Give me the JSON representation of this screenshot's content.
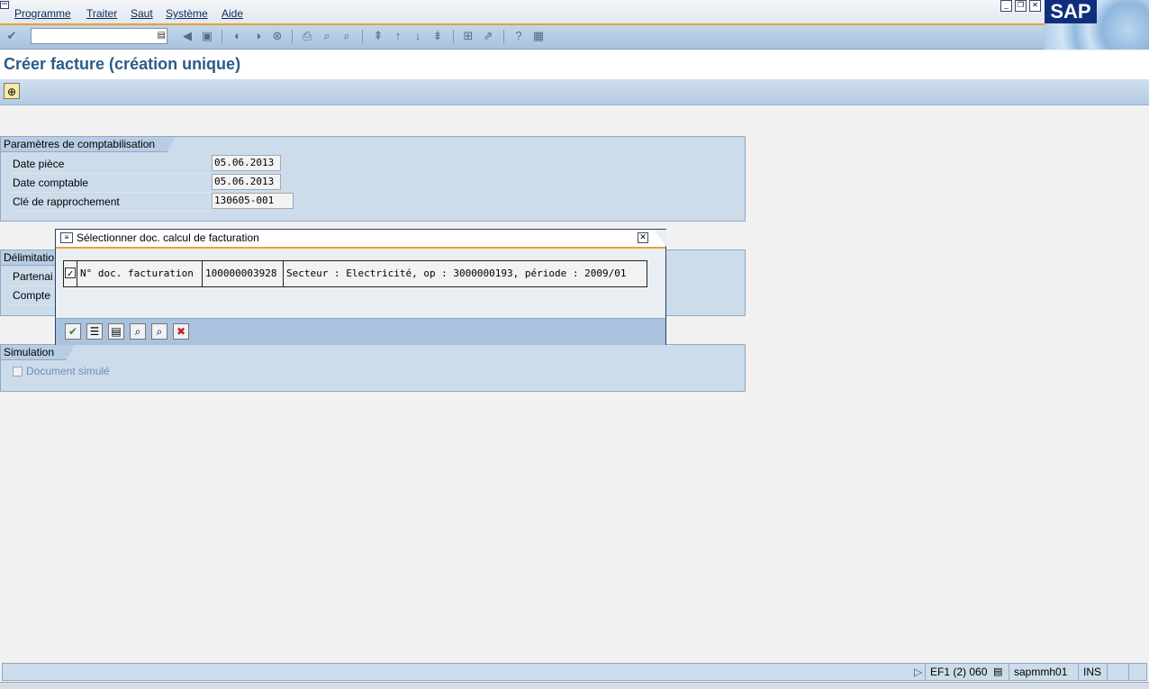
{
  "menu": {
    "items": [
      "Programme",
      "Traiter",
      "Saut",
      "Système",
      "Aide"
    ]
  },
  "logo": "SAP",
  "toolbar": {
    "command_value": "",
    "icons": [
      "enter-icon",
      "back-icon",
      "save-icon",
      "back-nav-icon",
      "exit-icon",
      "cancel-icon",
      "print-icon",
      "find-icon",
      "find-next-icon",
      "first-page-icon",
      "prev-page-icon",
      "next-page-icon",
      "last-page-icon",
      "new-session-icon",
      "shortcut-icon",
      "help-icon",
      "customize-layout-icon"
    ]
  },
  "page": {
    "title": "Créer facture (création unique)"
  },
  "posting": {
    "title": "Paramètres de comptabilisation",
    "date_piece_label": "Date pièce",
    "date_piece_value": "05.06.2013",
    "date_comptable_label": "Date comptable",
    "date_comptable_value": "05.06.2013",
    "cle_label": "Clé de rapprochement",
    "cle_value": "130605-001"
  },
  "delimitation": {
    "title": "Délimitatio",
    "partner_label": "Partenai",
    "account_label": "Compte"
  },
  "simulation": {
    "title": "Simulation",
    "checkbox_label": "Document simulé",
    "checked": false
  },
  "dialog": {
    "title": "Sélectionner doc. calcul de facturation",
    "row": {
      "checked": true,
      "label": "N° doc. facturation",
      "number": "100000003928",
      "description": "Secteur : Electricité, op : 3000000193, période : 2009/01"
    },
    "buttons": [
      "confirm-icon",
      "select-all-icon",
      "deselect-all-icon",
      "find-icon",
      "find-next-icon",
      "cancel-icon"
    ]
  },
  "status": {
    "system": "EF1 (2) 060",
    "server": "sapmmh01",
    "mode": "INS"
  }
}
